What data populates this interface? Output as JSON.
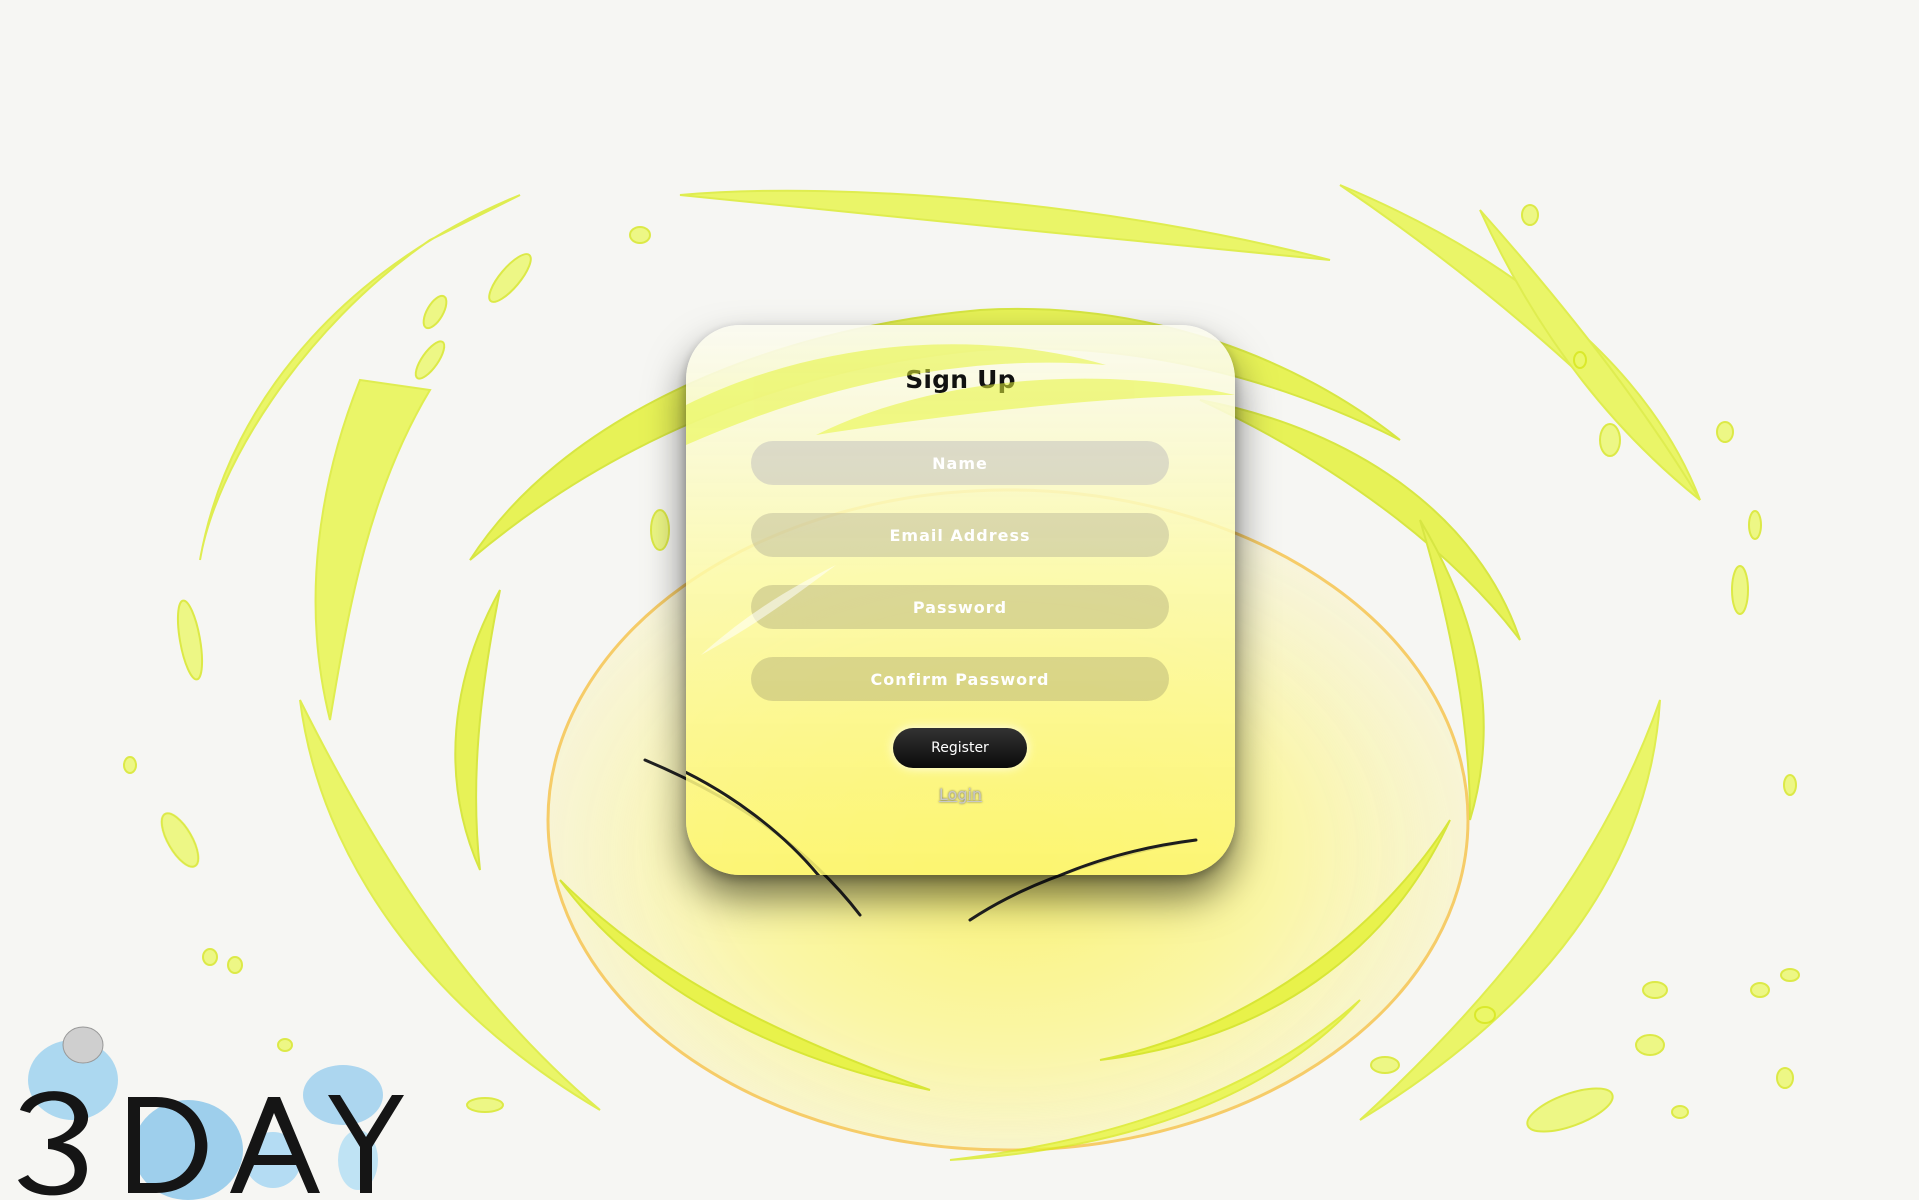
{
  "form": {
    "title": "Sign Up",
    "fields": [
      {
        "placeholder": "Name",
        "value": ""
      },
      {
        "placeholder": "Email Address",
        "value": ""
      },
      {
        "placeholder": "Password",
        "value": ""
      },
      {
        "placeholder": "Confirm Password",
        "value": ""
      }
    ],
    "register_label": "Register",
    "login_label": "Login"
  },
  "logo": {
    "text": "3DAY"
  },
  "colors": {
    "background": "#f6f6f3",
    "energy_yellow": "#e6f53a",
    "orb_yellow": "#fdf46a",
    "button_black": "#111111"
  }
}
